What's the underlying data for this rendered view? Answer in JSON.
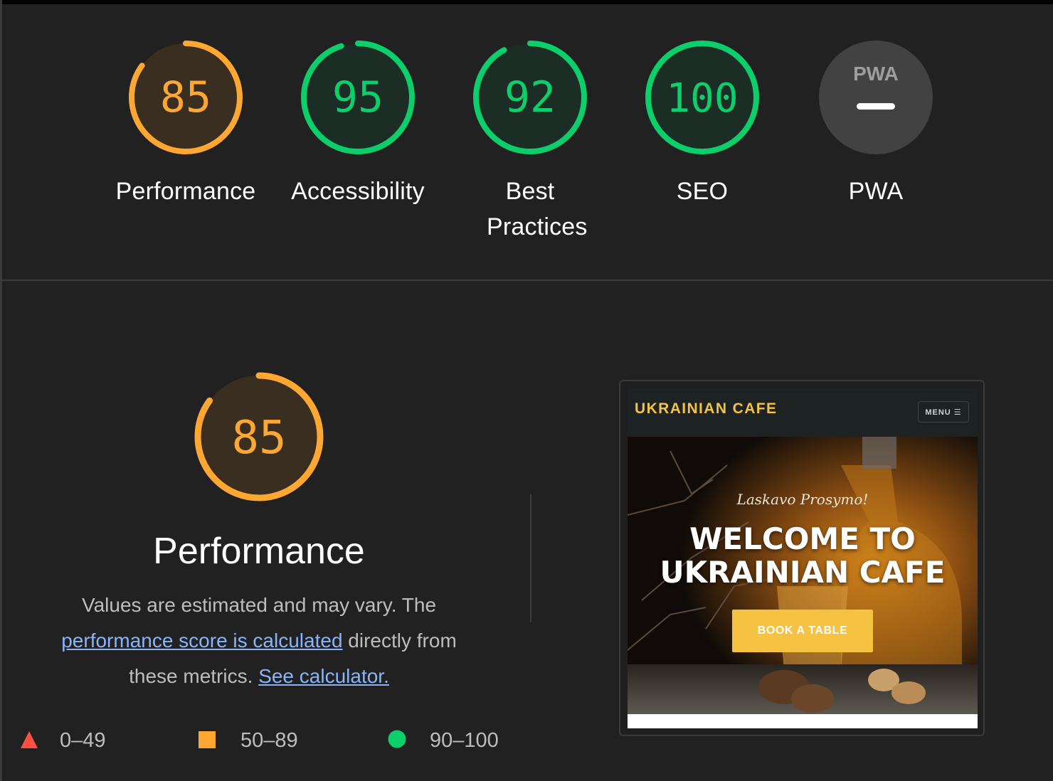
{
  "summary": {
    "gauges": [
      {
        "label": "Performance",
        "score": "85",
        "fraction": 0.85,
        "color": "#ffa733",
        "bg": "#3a2e21"
      },
      {
        "label": "Accessibility",
        "score": "95",
        "fraction": 0.95,
        "color": "#0cce6b",
        "bg": "#1c2d25"
      },
      {
        "label": "Best Practices",
        "score": "92",
        "fraction": 0.92,
        "color": "#0cce6b",
        "bg": "#1c2d25"
      },
      {
        "label": "SEO",
        "score": "100",
        "fraction": 1.0,
        "color": "#0cce6b",
        "bg": "#1c2d25"
      },
      {
        "label": "PWA",
        "badge": "PWA",
        "bg": "#424242"
      }
    ]
  },
  "performance": {
    "score": "85",
    "fraction": 0.85,
    "color": "#ffa733",
    "title": "Performance",
    "desc_part1": "Values are estimated and may vary. The",
    "desc_link1": "performance score is calculated",
    "desc_part2": "directly from these metrics.",
    "desc_link2": "See calculator."
  },
  "legend": [
    {
      "range": "0–49",
      "shape": "triangle",
      "color": "#ff4e42"
    },
    {
      "range": "50–89",
      "shape": "square",
      "color": "#ffa733"
    },
    {
      "range": "90–100",
      "shape": "circle",
      "color": "#0cce6b"
    }
  ],
  "screenshot": {
    "site_name": "UKRAINIAN CAFE",
    "menu_label": "MENU ☰",
    "script_text": "Laskavo Prosymo!",
    "hero_title": "WELCOME TO UKRAINIAN CAFE",
    "cta_label": "BOOK A TABLE"
  }
}
